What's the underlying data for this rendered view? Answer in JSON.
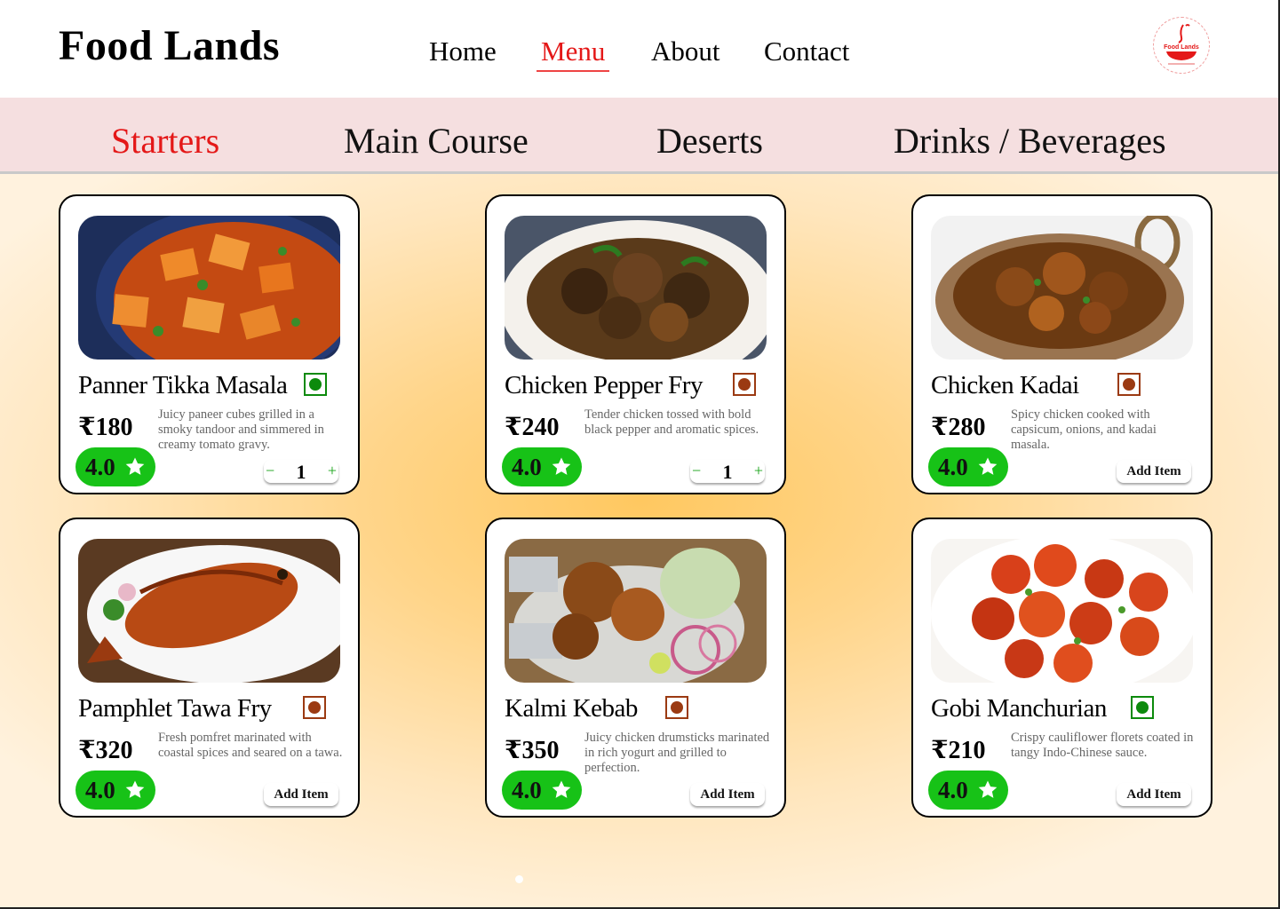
{
  "header": {
    "brand": "Food Lands",
    "nav": [
      {
        "label": "Home",
        "active": false
      },
      {
        "label": "Menu",
        "active": true
      },
      {
        "label": "About",
        "active": false
      },
      {
        "label": "Contact",
        "active": false
      }
    ],
    "logo_text": "Food Lands"
  },
  "categories": [
    {
      "label": "Starters",
      "active": true
    },
    {
      "label": "Main Course",
      "active": false
    },
    {
      "label": "Deserts",
      "active": false
    },
    {
      "label": "Drinks / Beverages",
      "active": false
    }
  ],
  "dishes": [
    {
      "name": "Panner Tikka Masala",
      "type": "veg",
      "price": "₹180",
      "description": "Juicy paneer cubes grilled in a smoky tandoor and simmered in creamy tomato gravy.",
      "rating": "4.0",
      "quantity": "1",
      "action": "stepper",
      "photo": "paneer-tikka-photo"
    },
    {
      "name": "Chicken Pepper Fry",
      "type": "non-veg",
      "price": "₹240",
      "description": "Tender chicken tossed with bold black pepper and aromatic spices.",
      "rating": "4.0",
      "quantity": "1",
      "action": "stepper",
      "photo": "chicken-pepper-fry-photo"
    },
    {
      "name": "Chicken Kadai",
      "type": "non-veg",
      "price": "₹280",
      "description": "Spicy chicken cooked with capsicum, onions, and kadai masala.",
      "rating": "4.0",
      "add_label": "Add Item",
      "action": "add",
      "photo": "chicken-kadai-photo"
    },
    {
      "name": "Pamphlet Tawa Fry",
      "type": "non-veg",
      "price": "₹320",
      "description": "Fresh pomfret marinated with coastal spices and seared on a tawa.",
      "rating": "4.0",
      "add_label": "Add Item",
      "action": "add",
      "photo": "pomfret-tawa-fry-photo"
    },
    {
      "name": "Kalmi Kebab",
      "type": "non-veg",
      "price": "₹350",
      "description": "Juicy chicken drumsticks marinated in rich yogurt and grilled to perfection.",
      "rating": "4.0",
      "add_label": "Add Item",
      "action": "add",
      "photo": "kalmi-kebab-photo"
    },
    {
      "name": "Gobi Manchurian",
      "type": "veg",
      "price": "₹210",
      "description": "Crispy cauliflower florets coated in tangy Indo-Chinese sauce.",
      "rating": "4.0",
      "add_label": "Add Item",
      "action": "add",
      "photo": "gobi-manchurian-photo"
    }
  ],
  "stepper_symbols": {
    "minus": "−",
    "plus": "+"
  },
  "colors": {
    "accent": "#e41818",
    "rating_green": "#17c217",
    "veg": "#0c8a0c",
    "non_veg": "#9b3a12",
    "category_bar": "#f5dfe0"
  }
}
